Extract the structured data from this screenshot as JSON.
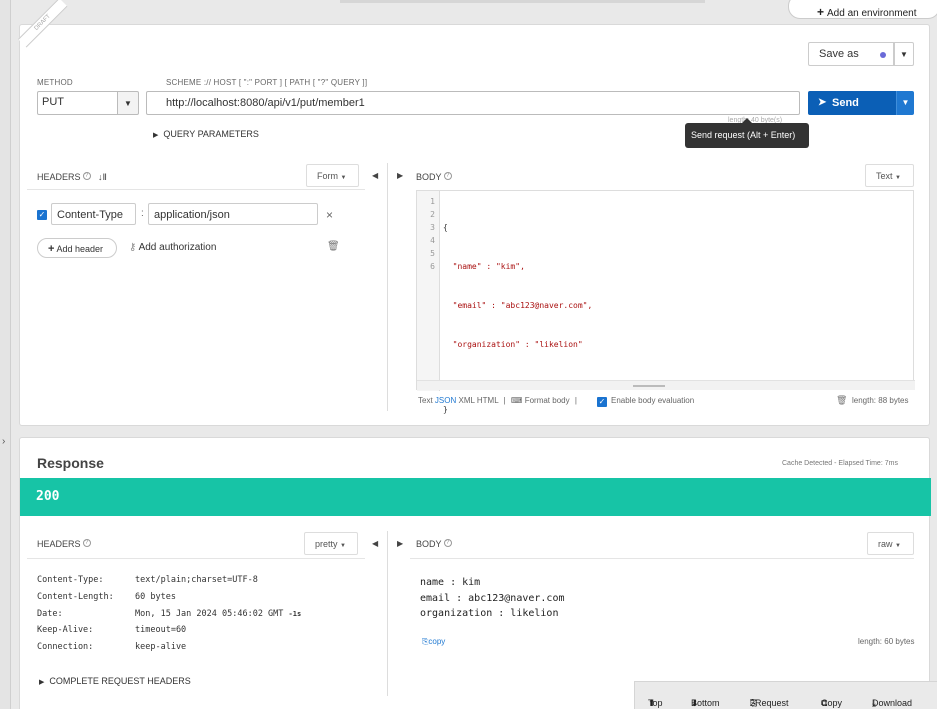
{
  "top": {
    "add_environment": "Add an environment"
  },
  "request": {
    "draft_ribbon": "DRAFT",
    "save_as_label": "Save as",
    "method_label": "METHOD",
    "method_value": "PUT",
    "scheme_hint": "SCHEME :// HOST [ \":\" PORT ] [ PATH [ \"?\" QUERY ]]",
    "url": "http://localhost:8080/api/v1/put/member1",
    "url_length_hint": "length: 40 byte(s)",
    "send_label": "Send",
    "tooltip": "Send request (Alt + Enter)",
    "query_parameters_label": "QUERY PARAMETERS",
    "headers_label": "HEADERS",
    "form_label": "Form",
    "header_rows": [
      {
        "name": "Content-Type",
        "value": "application/json",
        "checked": true
      }
    ],
    "add_header_label": "Add header",
    "add_authorization_label": "Add authorization",
    "body_label": "BODY",
    "body_type_label": "Text",
    "body_line_numbers": [
      "1",
      "2",
      "3",
      "4",
      "5",
      "6"
    ],
    "body_lines": [
      "{",
      "  \"name\" : \"kim\",",
      "  \"email\" : \"abc123@naver.com\",",
      "  \"organization\" : \"likelion\"",
      "",
      "}"
    ],
    "format_tabs": [
      "Text",
      "JSON",
      "XML",
      "HTML"
    ],
    "format_body_label": "Format body",
    "enable_body_evaluation_label": "Enable body evaluation",
    "body_length": "length: 88 bytes"
  },
  "response": {
    "title": "Response",
    "cache_note": "Cache Detected - Elapsed Time: 7ms",
    "status_code": "200",
    "headers_label": "HEADERS",
    "pretty_label": "pretty",
    "headers": [
      {
        "name": "Content-Type:",
        "value": "text/plain;charset=UTF-8"
      },
      {
        "name": "Content-Length:",
        "value": "60 bytes"
      },
      {
        "name": "Date:",
        "value": "Mon, 15 Jan 2024 05:46:02 GMT",
        "suffix": "-1s"
      },
      {
        "name": "Keep-Alive:",
        "value": "timeout=60"
      },
      {
        "name": "Connection:",
        "value": "keep-alive"
      }
    ],
    "complete_request_headers_label": "COMPLETE REQUEST HEADERS",
    "body_label": "BODY",
    "raw_label": "raw",
    "body_lines": [
      "name : kim",
      "email : abc123@naver.com",
      "organization : likelion"
    ],
    "copy_label": "copy",
    "body_length": "length: 60 bytes"
  },
  "bottom_bar": {
    "top_label": "Top",
    "bottom_label": "Bottom",
    "request_label": "2Request",
    "copy_label": "Copy",
    "download_label": "Download"
  },
  "colors": {
    "send": "#0b5fb6",
    "status_ok": "#17c4a6",
    "checkbox": "#1a73d0"
  }
}
